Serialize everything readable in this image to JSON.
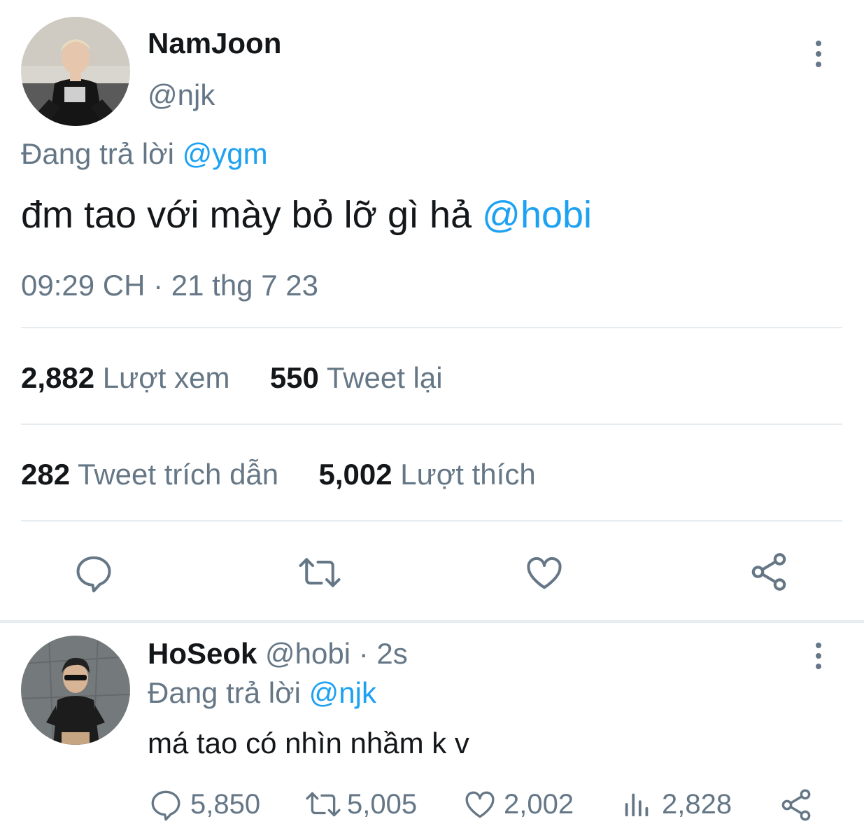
{
  "main_tweet": {
    "display_name": "NamJoon",
    "handle": "@njk",
    "replying_prefix": "Đang trả lời",
    "replying_to": "@ygm",
    "text": "đm tao với mày bỏ lỡ gì hả",
    "mention": "@hobi",
    "timestamp": "09:29 CH · 21 thg 7 23",
    "stats": {
      "views_count": "2,882",
      "views_label": "Lượt xem",
      "retweets_count": "550",
      "retweets_label": "Tweet lại",
      "quotes_count": "282",
      "quotes_label": "Tweet trích dẫn",
      "likes_count": "5,002",
      "likes_label": "Lượt thích"
    }
  },
  "reply_tweet": {
    "display_name": "HoSeok",
    "handle": "@hobi",
    "time": "· 2s",
    "replying_prefix": "Đang trả lời",
    "replying_to": "@njk",
    "text": "má tao có nhìn nhầm k v",
    "replies": "5,850",
    "retweets": "5,005",
    "likes": "2,002",
    "views": "2,828"
  },
  "colors": {
    "accent": "#1da1f2",
    "secondary_text": "#657786",
    "divider": "#e6ecf0"
  },
  "icons": [
    "more-vertical-icon",
    "reply-icon",
    "retweet-icon",
    "like-icon",
    "share-icon",
    "views-icon"
  ]
}
